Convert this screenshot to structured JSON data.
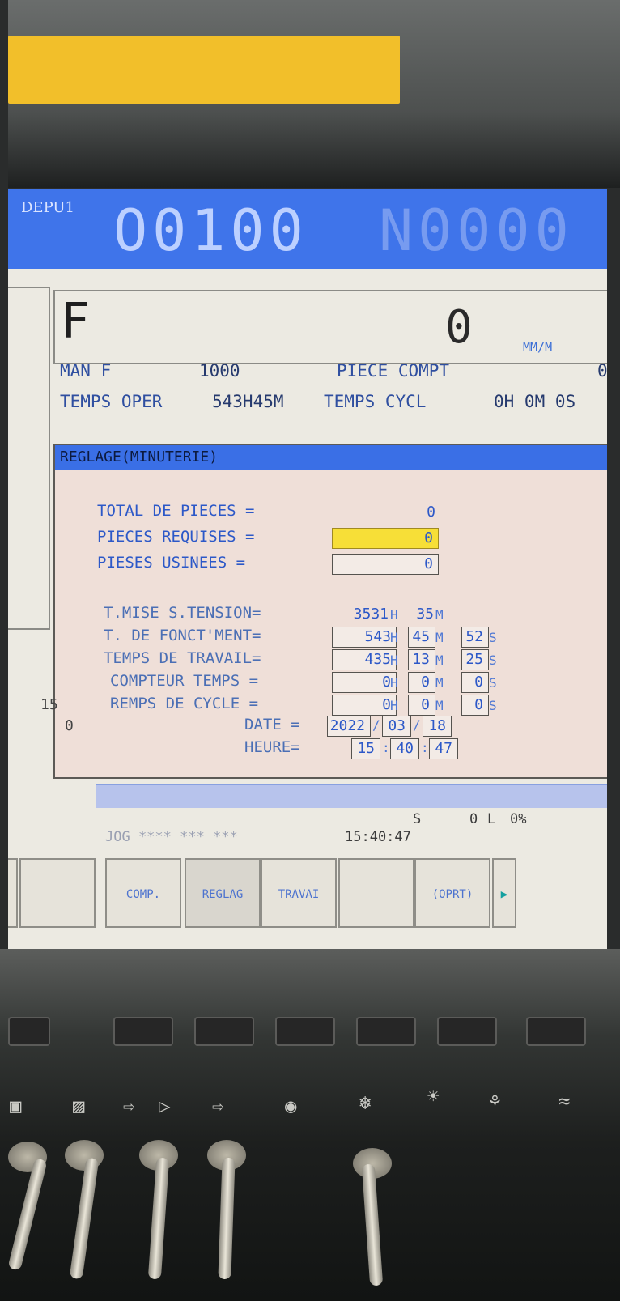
{
  "header": {
    "path": "DEPU1",
    "program": "O0100",
    "sequence": "N0000"
  },
  "feed": {
    "letter": "F",
    "value": "0",
    "unit": "MM/M"
  },
  "info": {
    "man_f_label": "MAN F",
    "man_f_value": "1000",
    "piece_compt_label": "PIECE COMPT",
    "piece_compt_value": "0",
    "temps_oper_label": "TEMPS OPER",
    "temps_oper_value": "543H45M",
    "temps_cycl_label": "TEMPS CYCL",
    "temps_cycl_value": "0H 0M 0S"
  },
  "popup": {
    "title": "REGLAGE(MINUTERIE)",
    "total_pieces_label": "TOTAL DE PIECES =",
    "total_pieces_value": "0",
    "pieces_requises_label": "PIECES REQUISES =",
    "pieces_requises_value": "0",
    "pieses_usinees_label": "PIESES USINEES  =",
    "pieses_usinees_value": "0",
    "mise_tension_label": "T.MISE S.TENSION=",
    "mise_tension_h": "3531",
    "mise_tension_m": "35",
    "fonct_label": "T. DE FONCT'MENT=",
    "fonct_h": "543",
    "fonct_m": "45",
    "fonct_s": "52",
    "travail_label": "TEMPS DE TRAVAIL=",
    "travail_h": "435",
    "travail_m": "13",
    "travail_s": "25",
    "compteur_label": "COMPTEUR TEMPS  =",
    "compteur_h": "0",
    "compteur_m": "0",
    "compteur_s": "0",
    "cycle_label": "REMPS DE CYCLE  =",
    "cycle_h": "0",
    "cycle_m": "0",
    "cycle_s": "0",
    "date_label": "DATE =",
    "date_y": "2022",
    "date_m": "03",
    "date_d": "18",
    "heure_label": "HEURE=",
    "heure_h": "15",
    "heure_m": "40",
    "heure_s": "47",
    "unit_h": "H",
    "unit_m": "M",
    "unit_s": "S",
    "sep_date": "/",
    "sep_time": ":"
  },
  "side_values": {
    "top": "15",
    "bottom": "0"
  },
  "status": {
    "s_label": "S",
    "s_value": "0",
    "l_label": "L",
    "l_value": "0%",
    "mode": "JOG **** *** ***",
    "clock": "15:40:47"
  },
  "softkeys": [
    "",
    "",
    "COMP.",
    "REGLAG",
    "TRAVAI",
    "",
    "(OPRT)",
    "▸"
  ],
  "colors": {
    "header": "#3f74ea",
    "popup_title": "#3a6fe6",
    "active_field": "#f7df37",
    "text_blue": "#2c58c8",
    "bezel_yellow": "#f2bf2a"
  }
}
